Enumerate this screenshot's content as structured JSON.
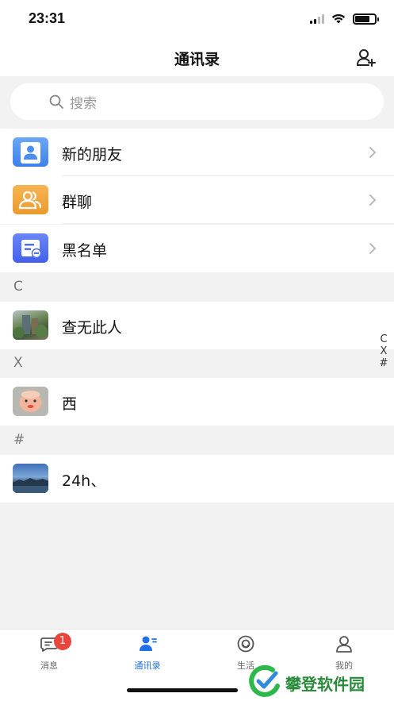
{
  "status_bar": {
    "time": "23:31"
  },
  "nav": {
    "title": "通讯录"
  },
  "search": {
    "placeholder": "搜索"
  },
  "fixed_items": [
    {
      "label": "新的朋友",
      "icon": "new-friends-icon",
      "color": "#4a8ef0"
    },
    {
      "label": "群聊",
      "icon": "group-chat-icon",
      "color": "#f0a33a"
    },
    {
      "label": "黑名单",
      "icon": "blacklist-icon",
      "color": "#4f6ff0"
    }
  ],
  "sections": [
    {
      "letter": "C",
      "contacts": [
        {
          "name": "查无此人"
        }
      ]
    },
    {
      "letter": "X",
      "contacts": [
        {
          "name": "西"
        }
      ]
    },
    {
      "letter": "#",
      "contacts": [
        {
          "name": "24h、"
        }
      ]
    }
  ],
  "index_bar": [
    "C",
    "X",
    "#"
  ],
  "tabs": [
    {
      "label": "消息",
      "badge": "1",
      "icon": "message-icon"
    },
    {
      "label": "通讯录",
      "icon": "contacts-icon",
      "active": true
    },
    {
      "label": "生活",
      "icon": "smile-icon"
    },
    {
      "label": "我的",
      "icon": "profile-icon"
    }
  ],
  "watermark": {
    "text": "攀登软件园"
  },
  "colors": {
    "accent": "#1f6fe6",
    "badge": "#e8453c"
  }
}
